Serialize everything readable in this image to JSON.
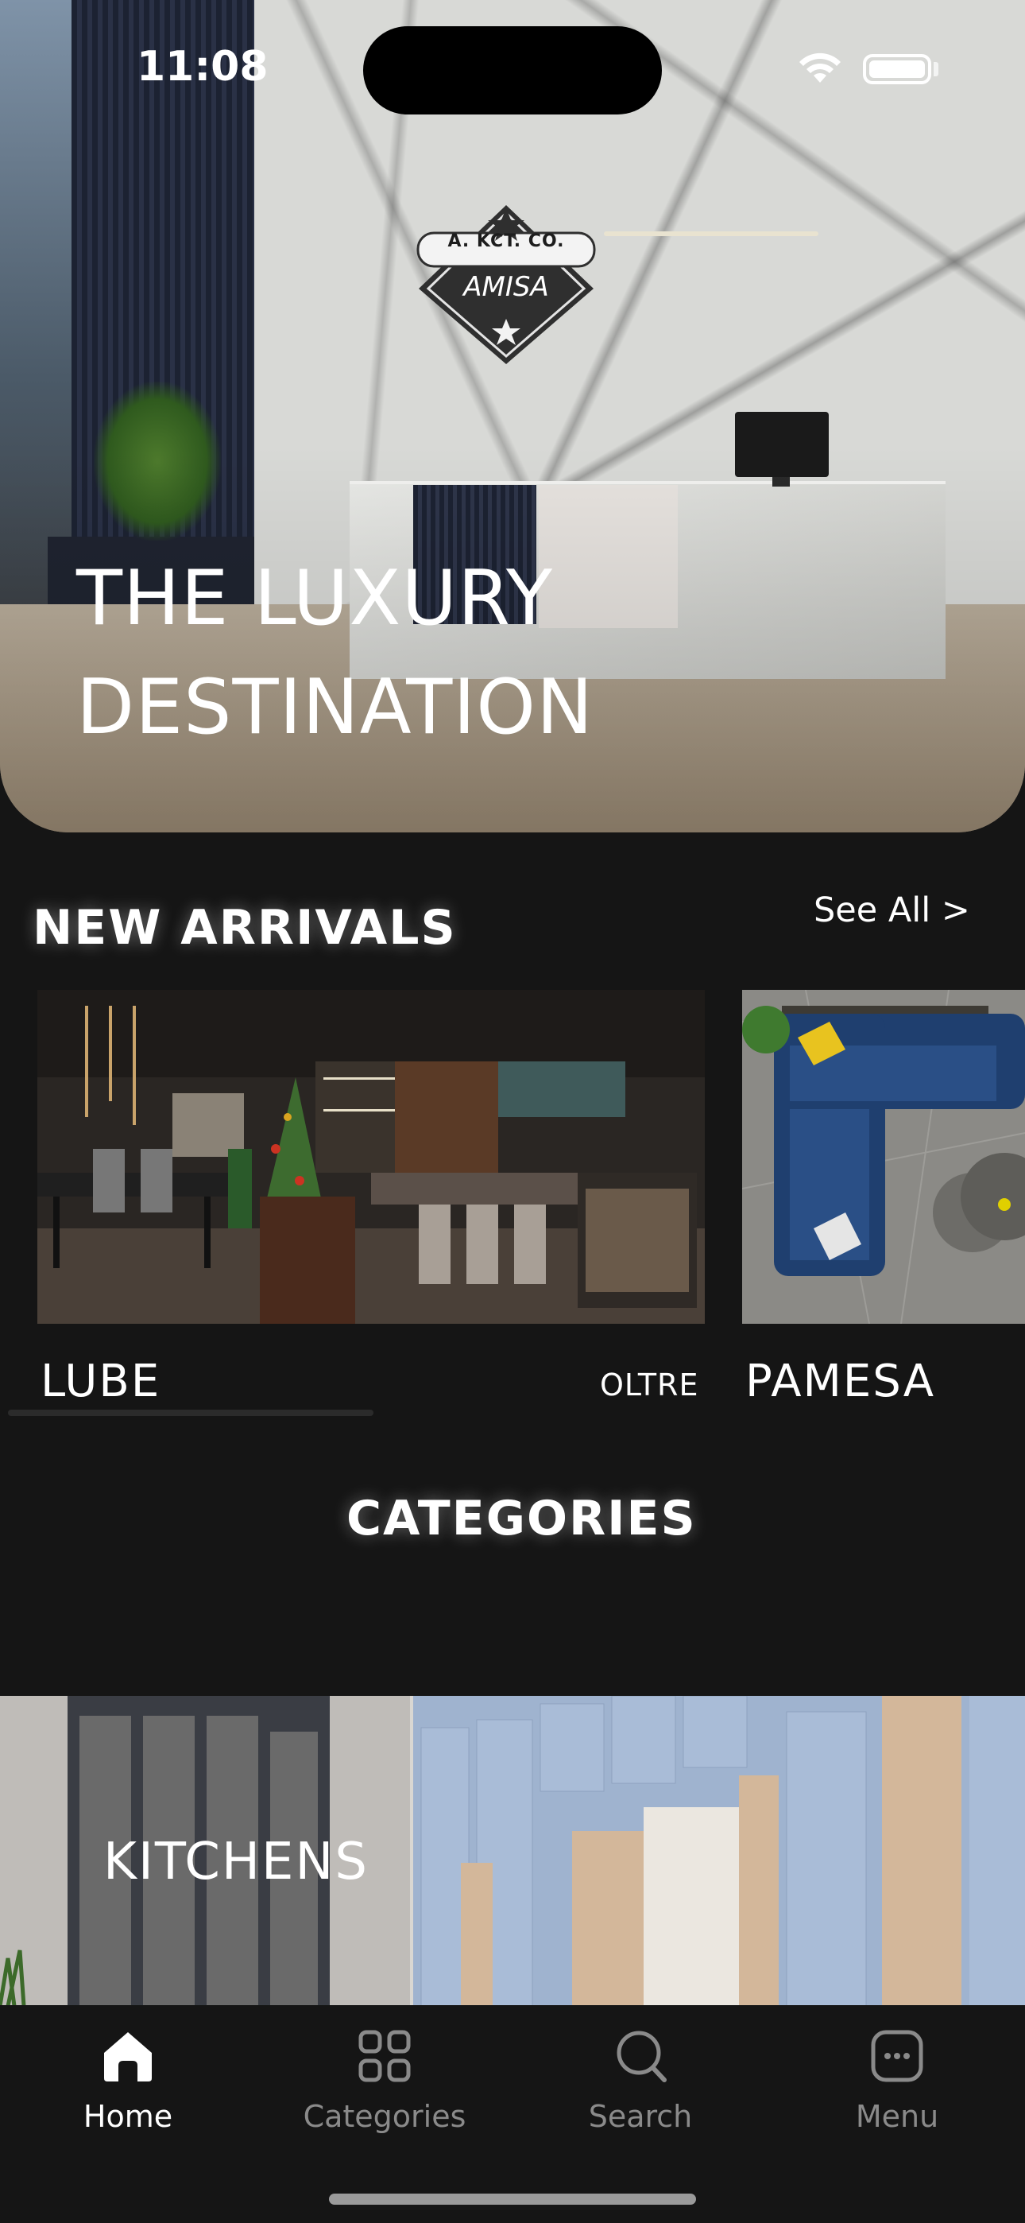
{
  "status_bar": {
    "time": "11:08"
  },
  "hero": {
    "logo_top": "A.   KCT.   CO.",
    "logo_brand": "AMISA",
    "title": "THE LUXURY\nDESTINATION"
  },
  "new_arrivals": {
    "title": "NEW ARRIVALS",
    "see_all": "See All >",
    "items": [
      {
        "label": "LUBE",
        "sublabel": "OLTRE"
      },
      {
        "label": "PAMESA"
      }
    ]
  },
  "categories": {
    "title": "CATEGORIES",
    "items": [
      {
        "label": "KITCHENS"
      }
    ]
  },
  "tab_bar": {
    "items": [
      {
        "label": "Home",
        "icon": "home-icon",
        "active": true
      },
      {
        "label": "Categories",
        "icon": "grid-icon"
      },
      {
        "label": "Search",
        "icon": "search-icon"
      },
      {
        "label": "Menu",
        "icon": "menu-icon"
      }
    ]
  },
  "colors": {
    "background": "#151515",
    "text": "#ffffff",
    "inactive_tab": "#8a8a8a"
  }
}
